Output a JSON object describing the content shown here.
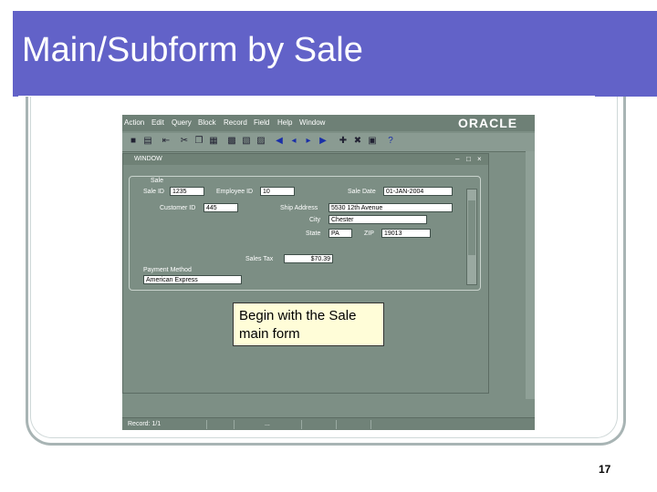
{
  "slide": {
    "title": "Main/Subform by Sale",
    "page_number": "17",
    "callout": "Begin with the Sale main form"
  },
  "app": {
    "brand": "ORACLE",
    "menu": [
      "Action",
      "Edit",
      "Query",
      "Block",
      "Record",
      "Field",
      "Help",
      "Window"
    ],
    "window_title": "WINDOW",
    "status": "Record: 1/1",
    "status_extra": "..."
  },
  "form": {
    "group_label": "Sale",
    "sale_id": {
      "label": "Sale ID",
      "value": "1235"
    },
    "employee_id": {
      "label": "Employee ID",
      "value": "10"
    },
    "sale_date": {
      "label": "Sale Date",
      "value": "01-JAN-2004"
    },
    "customer_id": {
      "label": "Customer ID",
      "value": "445"
    },
    "ship_address": {
      "label": "Ship Address",
      "value": "5530 12th Avenue"
    },
    "city": {
      "label": "City",
      "value": "Chester"
    },
    "state": {
      "label": "State",
      "value": "PA"
    },
    "zip": {
      "label": "ZIP",
      "value": "19013"
    },
    "sales_tax": {
      "label": "Sales Tax",
      "value": "$70.39"
    },
    "payment_method": {
      "label": "Payment Method",
      "value": "American Express"
    }
  }
}
